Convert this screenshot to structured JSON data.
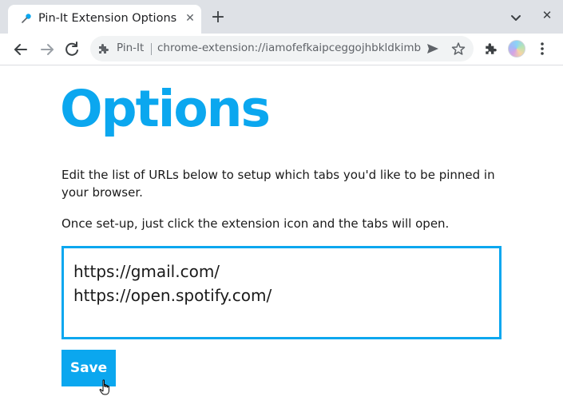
{
  "browser": {
    "tab": {
      "title": "Pin-It Extension Options",
      "close_label": "✕"
    },
    "new_tab_label": "+",
    "window_close_label": "✕",
    "omnibox": {
      "chip_label": "Pin-It",
      "url": "chrome-extension://iamofefkaipceggojhbkldkimbc…"
    }
  },
  "page": {
    "title": "Options",
    "description": "Edit the list of URLs below to setup which tabs you'd like to be pinned in your browser.",
    "instruction": "Once set-up, just click the extension icon and the tabs will open.",
    "urls": [
      "https://gmail.com/",
      "https://open.spotify.com/"
    ],
    "save_label": "Save"
  },
  "colors": {
    "accent": "#0ba7ef",
    "tabstrip": "#dee1e6",
    "omnibox": "#f1f3f4"
  },
  "icons": [
    "pin-favicon-icon",
    "close-icon",
    "plus-icon",
    "chevron-down-icon",
    "back-icon",
    "forward-icon",
    "reload-icon",
    "puzzle-icon",
    "send-icon",
    "star-icon",
    "avatar",
    "kebab-menu-icon",
    "hand-cursor-icon"
  ]
}
